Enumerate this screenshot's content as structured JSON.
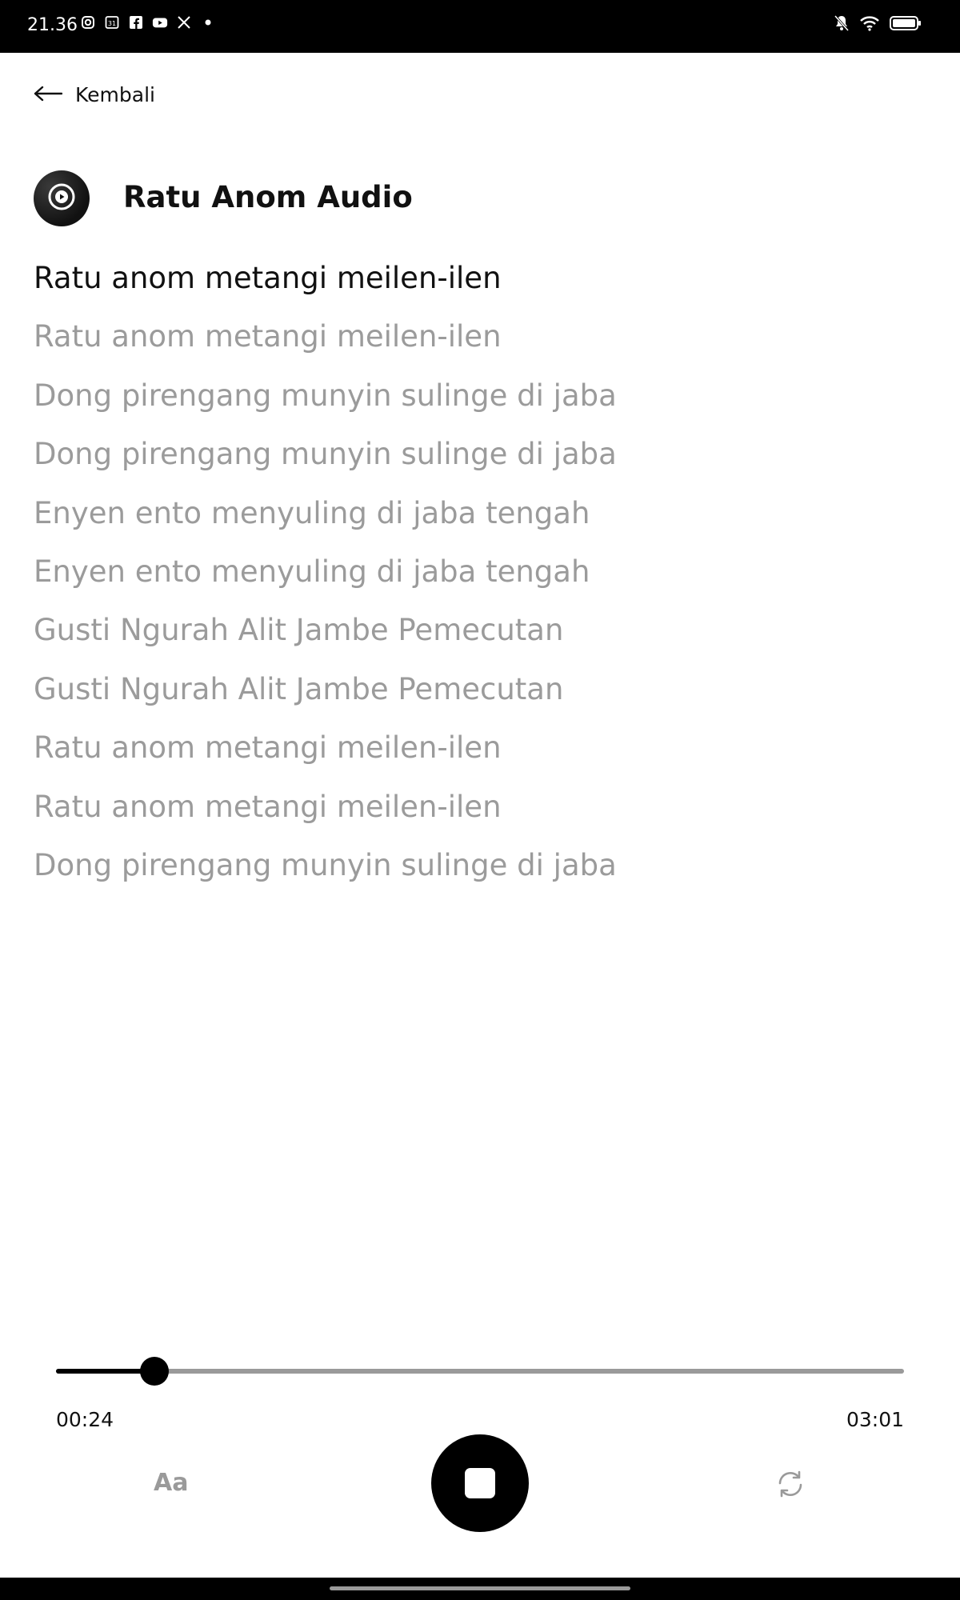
{
  "status_bar": {
    "time": "21.36",
    "icons": [
      "instagram-icon",
      "calendar-icon",
      "facebook-icon",
      "youtube-icon",
      "x-icon",
      "dot-icon"
    ],
    "calendar_text": "31",
    "right_icons": [
      "bell-off-icon",
      "wifi-icon",
      "battery-icon"
    ]
  },
  "nav": {
    "back_label": "Kembali"
  },
  "header": {
    "title": "Ratu Anom Audio"
  },
  "lyrics": [
    "Ratu anom metangi meilen-ilen",
    "Ratu anom metangi meilen-ilen",
    "Dong pirengang munyin sulinge di jaba",
    "Dong pirengang munyin sulinge di jaba",
    "Enyen ento menyuling di jaba tengah",
    "Enyen ento menyuling di jaba tengah",
    "Gusti Ngurah Alit Jambe Pemecutan",
    "Gusti Ngurah Alit Jambe Pemecutan",
    "Ratu anom metangi meilen-ilen",
    "Ratu anom metangi meilen-ilen",
    "Dong pirengang munyin sulinge di jaba"
  ],
  "active_line_index": 0,
  "player": {
    "current_time": "00:24",
    "total_time": "03:01",
    "progress": 0.116,
    "font_button_label": "Aa"
  },
  "colors": {
    "active_text": "#111111",
    "inactive_text": "#9b9b9b",
    "accent": "#000000"
  }
}
